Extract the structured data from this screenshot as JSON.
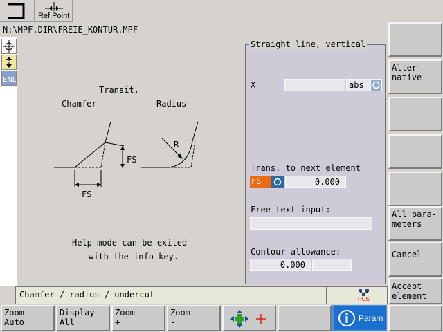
{
  "top": {
    "refpoint_label": "Ref Point"
  },
  "path": "N:\\MPF.DIR\\FREIE_KONTUR.MPF",
  "left_icons": [
    "target-icon",
    "vertical-arrows-icon",
    "end-icon"
  ],
  "help": {
    "transit": "Transit.",
    "chamfer": "Chamfer",
    "radius": "Radius",
    "fs_label": "FS",
    "r_label": "R",
    "exit_line1": "Help mode can be exited",
    "exit_line2": "with the info key."
  },
  "panel": {
    "title": "Straight line, vertical",
    "x_label": "X",
    "x_value": "",
    "x_unit": "abs",
    "trans_label": "Trans. to next element",
    "trans_mode": "FS",
    "trans_value": "0.000",
    "free_text_label": "Free text input:",
    "free_text_value": "",
    "allowance_label": "Contour allowance:",
    "allowance_value": "0.000"
  },
  "right_softkeys": [
    {
      "label": ""
    },
    {
      "label": "Alter-\nnative"
    },
    {
      "label": ""
    },
    {
      "label": ""
    },
    {
      "label": ""
    },
    {
      "label": "All para-\nmeters"
    },
    {
      "label": "Cancel"
    },
    {
      "label": "Accept\nelement"
    }
  ],
  "status": {
    "message": "Chamfer / radius / undercut",
    "rcs_label": "RCS"
  },
  "bottom_softkeys": [
    {
      "label": "Zoom\nAuto"
    },
    {
      "label": "Display\nAll"
    },
    {
      "label": "Zoom\n+"
    },
    {
      "label": "Zoom\n-"
    },
    {
      "label": ""
    },
    {
      "label": ""
    },
    {
      "label": "Param"
    },
    {
      "label": ""
    }
  ],
  "colors": {
    "accent_orange": "#ee6a12",
    "info_blue": "#1a6fcf",
    "panel_bg": "#cdcbd7"
  }
}
